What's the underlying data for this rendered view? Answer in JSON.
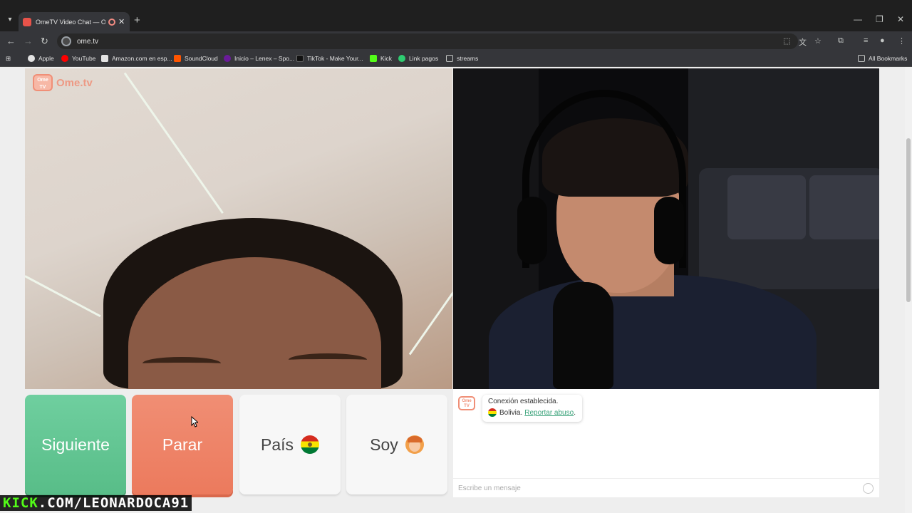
{
  "browser": {
    "tab_title": "OmeTV Video Chat — Ome",
    "url": "ome.tv",
    "bookmarks": [
      "Apple",
      "YouTube",
      "Amazon.com en esp...",
      "SoundCloud",
      "Inicio – Lenex – Spo...",
      "TikTok - Make Your...",
      "Kick",
      "Link pagos",
      "streams"
    ],
    "all_bookmarks": "All Bookmarks"
  },
  "site": {
    "logo_text": "Ome.tv",
    "logo_badge": "Ome TV"
  },
  "controls": {
    "next": "Siguiente",
    "stop": "Parar",
    "country": "País",
    "me": "Soy"
  },
  "chat": {
    "message_line1": "Conexión establecida.",
    "country": "Bolivia.",
    "report": "Reportar abuso",
    "report_suffix": ".",
    "placeholder": "Escribe un mensaje"
  },
  "overlay": {
    "brand": "KICK",
    "handle": ".COM/LEONARDOCA91"
  },
  "colors": {
    "next": "#5cc48f",
    "stop": "#ee8466",
    "brand": "#f08f77",
    "kick": "#53fc18"
  }
}
